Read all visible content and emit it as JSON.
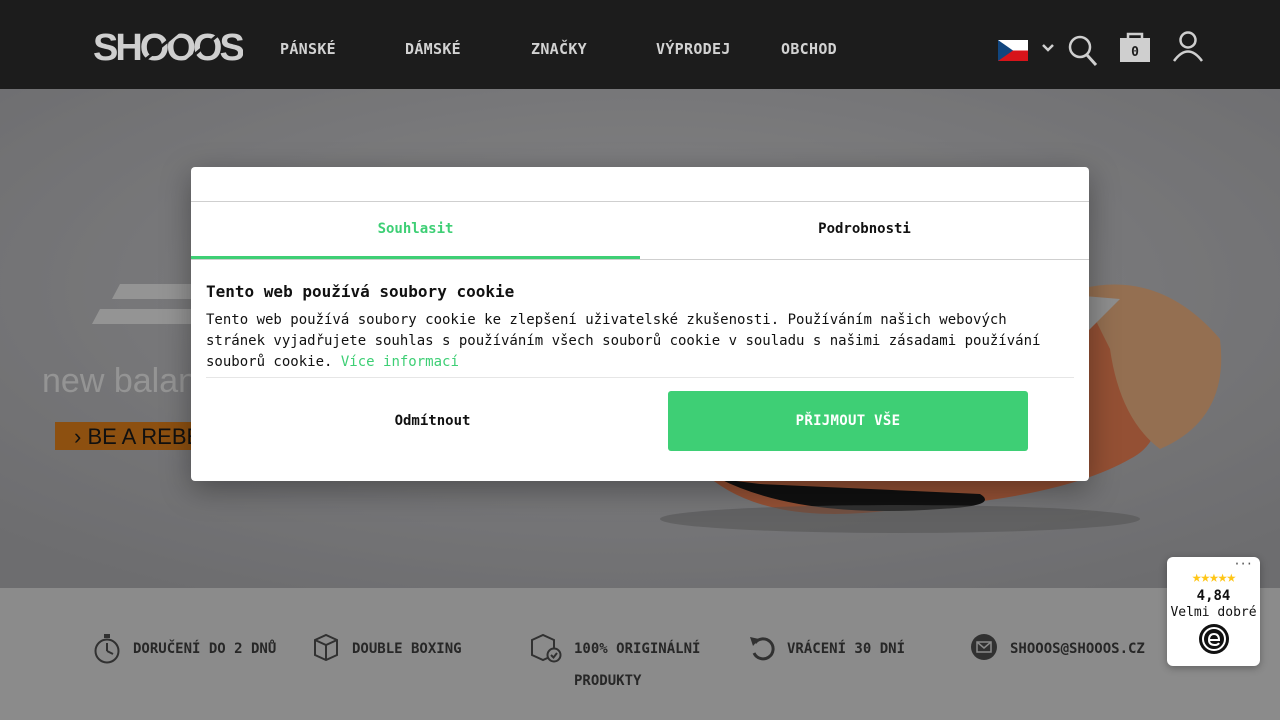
{
  "brand": {
    "logo_text": "SHOOOS"
  },
  "nav": {
    "items": [
      {
        "label": "PÁNSKÉ"
      },
      {
        "label": "DÁMSKÉ"
      },
      {
        "label": "ZNAČKY"
      },
      {
        "label": "VÝPRODEJ"
      },
      {
        "label": "OBCHOD"
      }
    ]
  },
  "header": {
    "language_icon": "czech-flag-icon",
    "cart_count": "0"
  },
  "hero": {
    "brand_text": "new balance",
    "tagline": "› BE A REBEL"
  },
  "cookie": {
    "tabs": [
      {
        "label": "Souhlasit"
      },
      {
        "label": "Podrobnosti"
      }
    ],
    "title": "Tento web používá soubory cookie",
    "text": "Tento web používá soubory cookie ke zlepšení uživatelské zkušenosti. Používáním našich webových stránek vyjadřujete souhlas s používáním všech souborů cookie v souladu s našimi zásadami používání souborů cookie.",
    "link": "Více informací",
    "reject": "Odmítnout",
    "accept": "PŘIJMOUT VŠE"
  },
  "features": [
    {
      "label": "DORUČENÍ DO 2 DNŮ",
      "icon": "stopwatch-icon"
    },
    {
      "label": "DOUBLE BOXING",
      "icon": "box-icon"
    },
    {
      "label": "100% ORIGINÁLNÍ PRODUKTY",
      "icon": "box-check-icon"
    },
    {
      "label": "VRÁCENÍ 30 DNÍ",
      "icon": "return-icon"
    },
    {
      "label": "SHOOOS@SHOOOS.CZ",
      "icon": "mail-icon"
    }
  ],
  "trust": {
    "stars": "★★★★★",
    "score": "4,84",
    "label": "Velmi dobré",
    "more": "···"
  },
  "colors": {
    "accent": "#3ecf75",
    "header_bg": "#1c1c1c",
    "star": "#ffc617"
  }
}
